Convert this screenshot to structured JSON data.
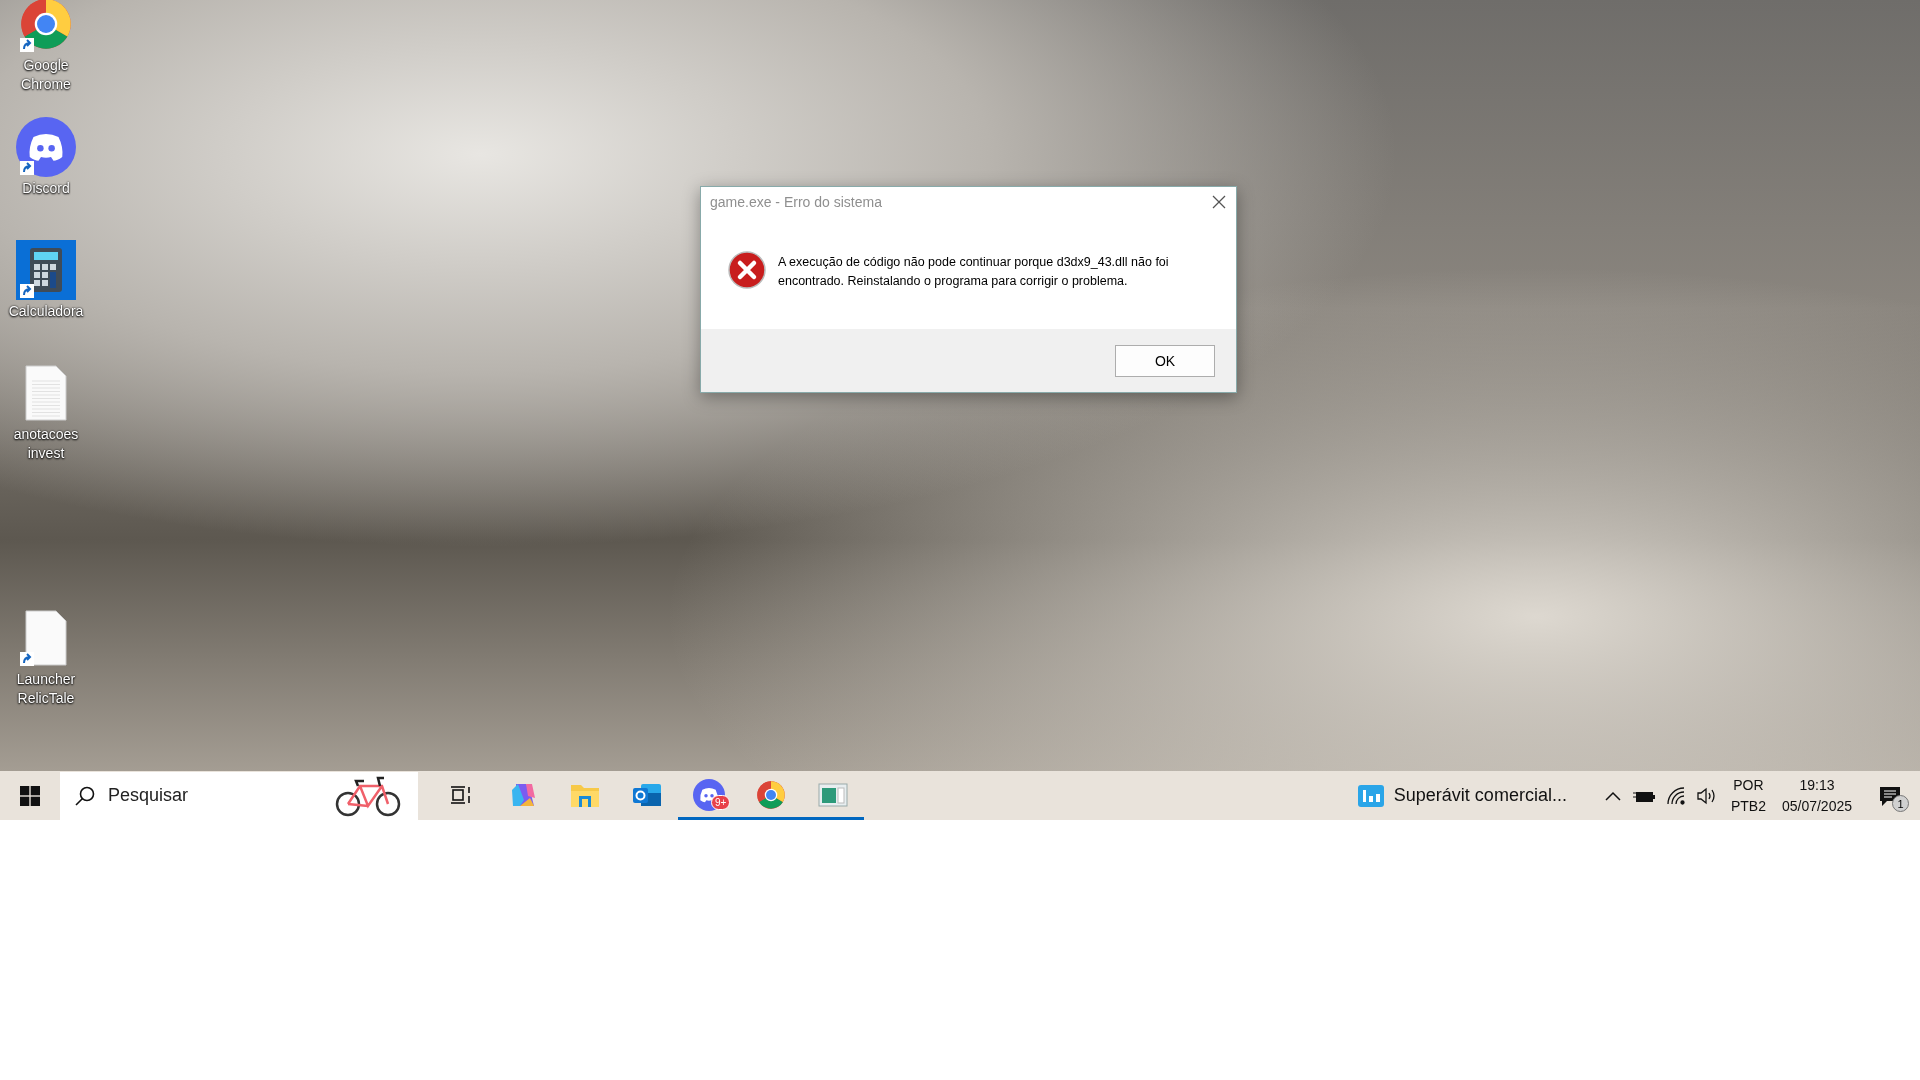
{
  "desktop_icons": [
    {
      "label": "Google Chrome",
      "kind": "chrome",
      "shortcut": true
    },
    {
      "label": "Discord",
      "kind": "discord",
      "shortcut": true
    },
    {
      "label": "Calculadora",
      "kind": "calculator",
      "shortcut": true
    },
    {
      "label": "anotacoes invest",
      "kind": "document",
      "shortcut": false
    },
    {
      "label": "Launcher RelicTale",
      "kind": "blank",
      "shortcut": true
    }
  ],
  "dialog": {
    "title": "game.exe - Erro do sistema",
    "message": "A execução de código não pode continuar porque d3dx9_43.dll não foi encontrado. Reinstalando o programa para corrigir o problema.",
    "button": "OK"
  },
  "taskbar": {
    "search": {
      "placeholder": "Pesquisar"
    },
    "apps": [
      {
        "kind": "taskview",
        "running": false
      },
      {
        "kind": "copilot",
        "running": false
      },
      {
        "kind": "explorer",
        "running": false
      },
      {
        "kind": "outlook",
        "running": false
      },
      {
        "kind": "discord",
        "running": true,
        "badge": "9+"
      },
      {
        "kind": "chrome",
        "running": true
      },
      {
        "kind": "window",
        "running": true
      }
    ],
    "news": "Superávit comercial...",
    "language": [
      "POR",
      "PTB2"
    ],
    "time": "19:13",
    "date": "05/07/2025",
    "notifications": "1"
  }
}
